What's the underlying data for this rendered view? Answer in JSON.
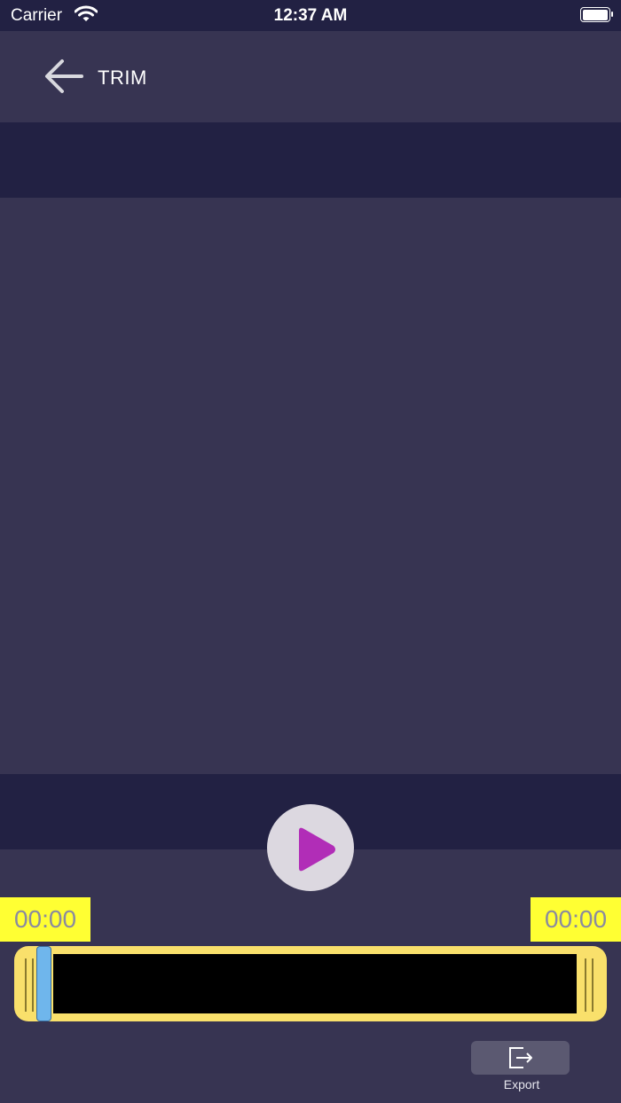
{
  "status_bar": {
    "carrier": "Carrier",
    "time": "12:37 AM"
  },
  "nav": {
    "title": "TRIM",
    "back_icon": "arrow-left-icon"
  },
  "player": {
    "play_icon": "play-icon",
    "play_color": "#b12db7"
  },
  "trim": {
    "start_time": "00:00",
    "end_time": "00:00",
    "badge_color": "#ffff33",
    "track_color": "#f9e06b",
    "playhead_color": "#6fb6ec"
  },
  "export": {
    "label": "Export",
    "icon": "export-icon"
  },
  "colors": {
    "background": "#373452",
    "band": "#222143"
  }
}
